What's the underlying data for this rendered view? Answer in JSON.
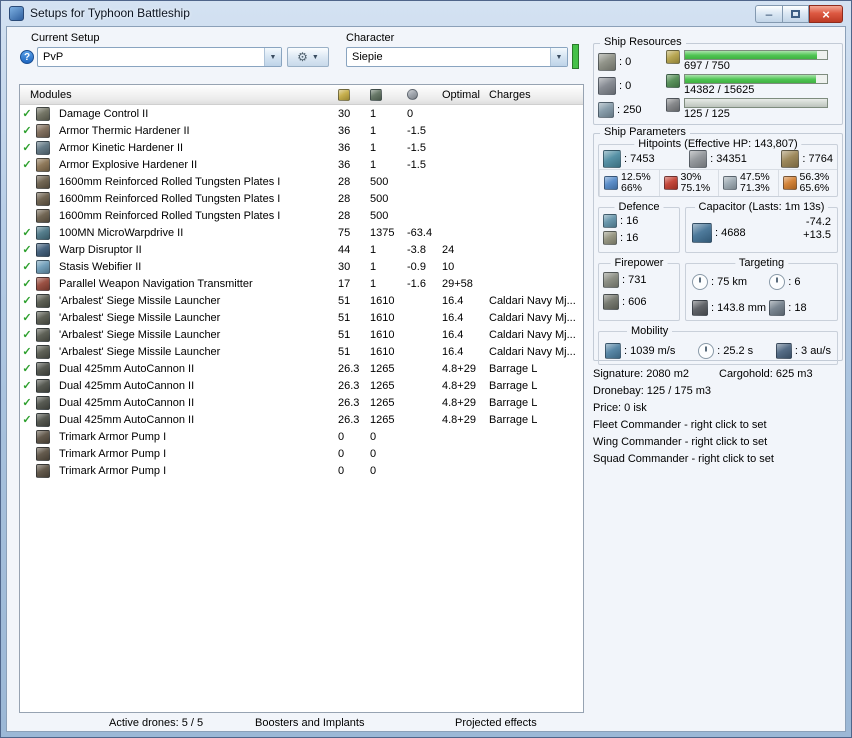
{
  "window": {
    "title": "Setups for Typhoon Battleship",
    "minimize_glyph": "–",
    "close_glyph": "×"
  },
  "icons": {
    "check": "✓",
    "dropdown_arrow": "▼",
    "help": "?",
    "tools": "⚙"
  },
  "toolbar": {
    "current_setup_label": "Current Setup",
    "setup_value": "PvP",
    "character_label": "Character",
    "character_value": "Siepie"
  },
  "modules_table": {
    "modules_header": "Modules",
    "optimal_header": "Optimal",
    "charges_header": "Charges",
    "rows": [
      {
        "active": true,
        "icon": "damage-control-icon",
        "color": "#6e6f5f",
        "name": "Damage Control II",
        "cpu": "30",
        "pg": "1",
        "cap": "0",
        "optimal": "",
        "charges": ""
      },
      {
        "active": true,
        "icon": "armor-thermic-hardener-icon",
        "color": "#7d6a58",
        "name": "Armor Thermic Hardener II",
        "cpu": "36",
        "pg": "1",
        "cap": "-1.5",
        "optimal": "",
        "charges": ""
      },
      {
        "active": true,
        "icon": "armor-kinetic-hardener-icon",
        "color": "#5f7582",
        "name": "Armor Kinetic Hardener II",
        "cpu": "36",
        "pg": "1",
        "cap": "-1.5",
        "optimal": "",
        "charges": ""
      },
      {
        "active": true,
        "icon": "armor-explosive-hardener-icon",
        "color": "#8a7353",
        "name": "Armor Explosive Hardener II",
        "cpu": "36",
        "pg": "1",
        "cap": "-1.5",
        "optimal": "",
        "charges": ""
      },
      {
        "active": false,
        "icon": "armor-plate-icon",
        "color": "#6b5f4c",
        "name": "1600mm Reinforced Rolled Tungsten Plates I",
        "cpu": "28",
        "pg": "500",
        "cap": "",
        "optimal": "",
        "charges": ""
      },
      {
        "active": false,
        "icon": "armor-plate-icon",
        "color": "#6b5f4c",
        "name": "1600mm Reinforced Rolled Tungsten Plates I",
        "cpu": "28",
        "pg": "500",
        "cap": "",
        "optimal": "",
        "charges": ""
      },
      {
        "active": false,
        "icon": "armor-plate-icon",
        "color": "#6b5f4c",
        "name": "1600mm Reinforced Rolled Tungsten Plates I",
        "cpu": "28",
        "pg": "500",
        "cap": "",
        "optimal": "",
        "charges": ""
      },
      {
        "active": true,
        "icon": "microwarpdrive-icon",
        "color": "#4c7787",
        "name": "100MN MicroWarpdrive II",
        "cpu": "75",
        "pg": "1375",
        "cap": "-63.4",
        "optimal": "",
        "charges": ""
      },
      {
        "active": true,
        "icon": "warp-disruptor-icon",
        "color": "#3f5d7a",
        "name": "Warp Disruptor II",
        "cpu": "44",
        "pg": "1",
        "cap": "-3.8",
        "optimal": "24",
        "charges": ""
      },
      {
        "active": true,
        "icon": "stasis-webifier-icon",
        "color": "#6d9cb8",
        "name": "Stasis Webifier II",
        "cpu": "30",
        "pg": "1",
        "cap": "-0.9",
        "optimal": "10",
        "charges": ""
      },
      {
        "active": true,
        "icon": "weapon-nav-transmitter-icon",
        "color": "#96483a",
        "name": "Parallel Weapon Navigation Transmitter",
        "cpu": "17",
        "pg": "1",
        "cap": "-1.6",
        "optimal": "29+58",
        "charges": ""
      },
      {
        "active": true,
        "icon": "siege-missile-launcher-icon",
        "color": "#575a4f",
        "name": "'Arbalest' Siege Missile Launcher",
        "cpu": "51",
        "pg": "1610",
        "cap": "",
        "optimal": "16.4",
        "charges": "Caldari Navy Mj..."
      },
      {
        "active": true,
        "icon": "siege-missile-launcher-icon",
        "color": "#575a4f",
        "name": "'Arbalest' Siege Missile Launcher",
        "cpu": "51",
        "pg": "1610",
        "cap": "",
        "optimal": "16.4",
        "charges": "Caldari Navy Mj..."
      },
      {
        "active": true,
        "icon": "siege-missile-launcher-icon",
        "color": "#575a4f",
        "name": "'Arbalest' Siege Missile Launcher",
        "cpu": "51",
        "pg": "1610",
        "cap": "",
        "optimal": "16.4",
        "charges": "Caldari Navy Mj..."
      },
      {
        "active": true,
        "icon": "siege-missile-launcher-icon",
        "color": "#575a4f",
        "name": "'Arbalest' Siege Missile Launcher",
        "cpu": "51",
        "pg": "1610",
        "cap": "",
        "optimal": "16.4",
        "charges": "Caldari Navy Mj..."
      },
      {
        "active": true,
        "icon": "autocannon-icon",
        "color": "#4f524a",
        "name": "Dual 425mm AutoCannon II",
        "cpu": "26.3",
        "pg": "1265",
        "cap": "",
        "optimal": "4.8+29",
        "charges": "Barrage L"
      },
      {
        "active": true,
        "icon": "autocannon-icon",
        "color": "#4f524a",
        "name": "Dual 425mm AutoCannon II",
        "cpu": "26.3",
        "pg": "1265",
        "cap": "",
        "optimal": "4.8+29",
        "charges": "Barrage L"
      },
      {
        "active": true,
        "icon": "autocannon-icon",
        "color": "#4f524a",
        "name": "Dual 425mm AutoCannon II",
        "cpu": "26.3",
        "pg": "1265",
        "cap": "",
        "optimal": "4.8+29",
        "charges": "Barrage L"
      },
      {
        "active": true,
        "icon": "autocannon-icon",
        "color": "#4f524a",
        "name": "Dual 425mm AutoCannon II",
        "cpu": "26.3",
        "pg": "1265",
        "cap": "",
        "optimal": "4.8+29",
        "charges": "Barrage L"
      },
      {
        "active": false,
        "icon": "trimark-rig-icon",
        "color": "#5c5244",
        "name": "Trimark Armor Pump I",
        "cpu": "0",
        "pg": "0",
        "cap": "",
        "optimal": "",
        "charges": ""
      },
      {
        "active": false,
        "icon": "trimark-rig-icon",
        "color": "#5c5244",
        "name": "Trimark Armor Pump I",
        "cpu": "0",
        "pg": "0",
        "cap": "",
        "optimal": "",
        "charges": ""
      },
      {
        "active": false,
        "icon": "trimark-rig-icon",
        "color": "#5c5244",
        "name": "Trimark Armor Pump I",
        "cpu": "0",
        "pg": "0",
        "cap": "",
        "optimal": "",
        "charges": ""
      }
    ]
  },
  "bottom_sections": [
    {
      "label": "Active drones: 5 / 5"
    },
    {
      "label": "Boosters and Implants"
    },
    {
      "label": "Projected effects"
    }
  ],
  "ship_resources": {
    "title": "Ship Resources",
    "turrets_value": ": 0",
    "launchers_value": ": 0",
    "calibration_value": ": 250",
    "cpu_text": "697 / 750",
    "cpu_pct": 93,
    "powergrid_text": "14382 / 15625",
    "powergrid_pct": 92,
    "drone_text": "125 / 125",
    "drone_pct": 100,
    "bar_green": "#45c148",
    "bar_gray": "#cdd4cd"
  },
  "ship_parameters": {
    "title": "Ship Parameters",
    "hitpoints_title": "Hitpoints (Effective HP: 143,807)",
    "shield_hp": ": 7453",
    "armor_hp": ": 34351",
    "hull_hp": ": 7764",
    "resists": [
      {
        "icon": "em-resist-icon",
        "color": "#4f86c6",
        "shield": "12.5%",
        "armor": "66%"
      },
      {
        "icon": "thermal-resist-icon",
        "color": "#c0392b",
        "shield": "30%",
        "armor": "75.1%"
      },
      {
        "icon": "kinetic-resist-icon",
        "color": "#9aa7b0",
        "shield": "47.5%",
        "armor": "71.3%"
      },
      {
        "icon": "explosive-resist-icon",
        "color": "#d07a2a",
        "shield": "56.3%",
        "armor": "65.6%"
      }
    ],
    "defence_title": "Defence",
    "defence_v1": ": 16",
    "defence_v2": ": 16",
    "capacitor_title": "Capacitor (Lasts: 1m 13s)",
    "capacitor_amount": ": 4688",
    "capacitor_out": "-74.2",
    "capacitor_in": "+13.5",
    "firepower_title": "Firepower",
    "volley": ": 731",
    "dps": ": 606",
    "targeting_title": "Targeting",
    "targeting_range": ": 75 km",
    "max_targets": ": 6",
    "scan_resolution": ": 143.8 mm",
    "sensor_strength": ": 18",
    "mobility_title": "Mobility",
    "speed": ": 1039 m/s",
    "align_time": ": 25.2 s",
    "warp_speed": ": 3 au/s"
  },
  "info": {
    "signature": "Signature: 2080 m2",
    "cargohold": "Cargohold: 625 m3",
    "dronebay": "Dronebay: 125 / 175 m3",
    "price": "Price: 0 isk",
    "fleet_commander": "Fleet Commander - right click to set",
    "wing_commander": "Wing Commander - right click to set",
    "squad_commander": "Squad Commander - right click to set"
  }
}
